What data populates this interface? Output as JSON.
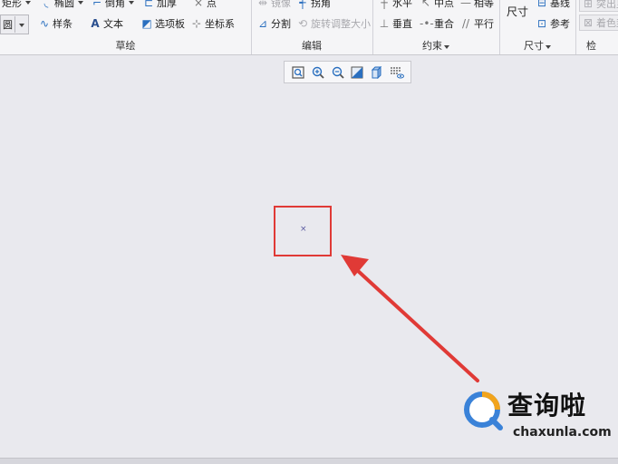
{
  "ribbon": {
    "sketch_group": {
      "label": "草绘",
      "row1": [
        "矩形",
        "椭圆",
        "倒角",
        "加厚",
        "点"
      ],
      "row2": [
        "圆",
        "样条",
        "文本",
        "选项板",
        "坐标系"
      ]
    },
    "edit_group": {
      "label": "编辑",
      "row1": [
        "镜像",
        "拐角"
      ],
      "split": "分割",
      "rotate_resize": "旋转调整大小"
    },
    "constraint_group": {
      "label": "约束",
      "row1": [
        "水平",
        "中点",
        "相等"
      ],
      "row2": [
        "垂直",
        "重合",
        "平行"
      ]
    },
    "dimension_group": {
      "label": "尺寸",
      "dimension": "尺寸",
      "baseline": "基线",
      "reference": "参考"
    },
    "inspect_group": {
      "label": "检",
      "row1": "突出显示",
      "row2": "着色封闭"
    }
  },
  "canvas": {
    "point_marker": "×"
  },
  "annotation": {
    "highlight_color": "#e03a36",
    "arrow_color": "#e03a36"
  },
  "watermark": {
    "title": "查询啦",
    "subtitle": "chaxunla.com",
    "logo_color": "#3a82d8",
    "logo_accent": "#f2a41c"
  }
}
